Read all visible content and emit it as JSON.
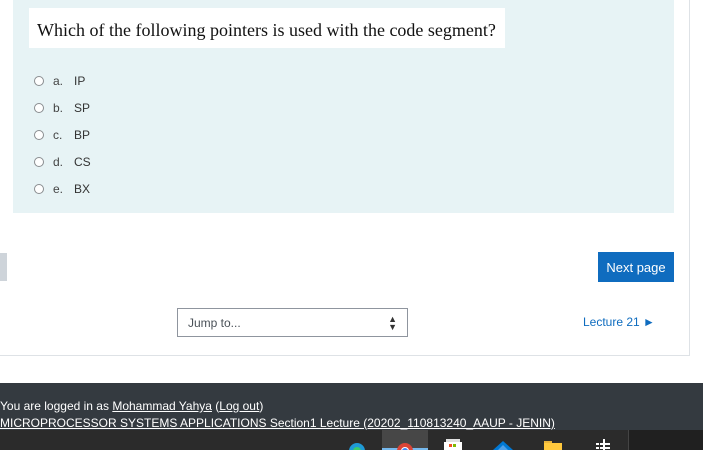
{
  "question": {
    "text": "Which of the following pointers is used with the code segment?",
    "answers": [
      {
        "letter": "a.",
        "text": "IP"
      },
      {
        "letter": "b.",
        "text": "SP"
      },
      {
        "letter": "c.",
        "text": "BP"
      },
      {
        "letter": "d.",
        "text": "CS"
      },
      {
        "letter": "e.",
        "text": "BX"
      }
    ]
  },
  "navigation": {
    "next_page_label": "Next page",
    "prev_fragment": ")",
    "jump_placeholder": "Jump to...",
    "next_activity_label": "Lecture 21 ►"
  },
  "footer": {
    "logged_in_prefix": "You are logged in as",
    "user_name": "Mohammad Yahya",
    "logout_open": "(",
    "logout_label": "Log out",
    "logout_close": ")",
    "course_link": "MICROPROCESSOR SYSTEMS APPLICATIONS Section1 Lecture (20202_110813240_AAUP - JENIN)"
  },
  "taskbar": {
    "icons": [
      "edge-icon",
      "chrome-icon",
      "store-icon",
      "mail-icon",
      "file-explorer-icon",
      "task-icon"
    ]
  },
  "colors": {
    "accent": "#0f6cbf",
    "question_bg": "#e7f3f5",
    "footer_bg": "#343a40"
  }
}
